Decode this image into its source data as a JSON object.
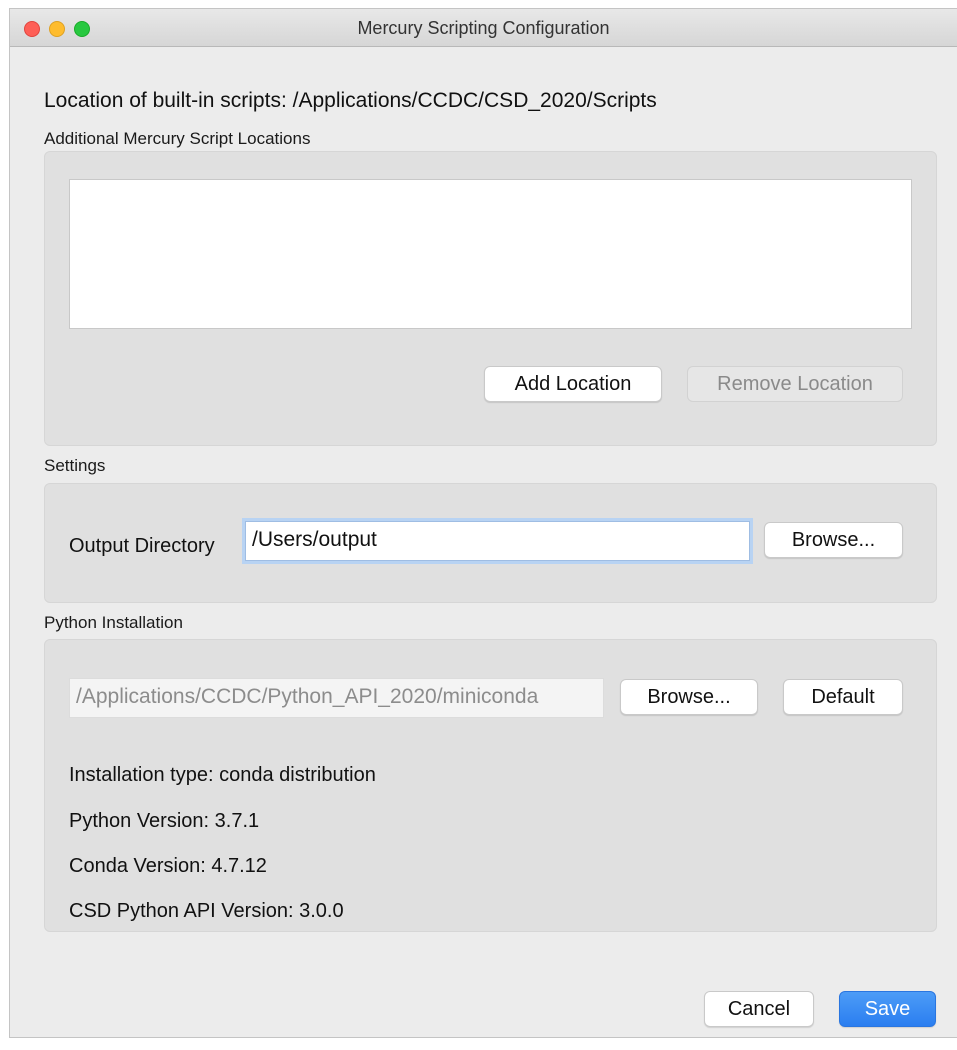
{
  "window": {
    "title": "Mercury Scripting Configuration"
  },
  "builtin": {
    "label": "Location of built-in scripts: /Applications/CCDC/CSD_2020/Scripts"
  },
  "additional": {
    "label": "Additional Mercury Script Locations",
    "add_button": "Add Location",
    "remove_button": "Remove Location"
  },
  "settings": {
    "label": "Settings",
    "output_label": "Output Directory",
    "output_value": "/Users/output",
    "browse_button": "Browse..."
  },
  "python": {
    "label": "Python Installation",
    "path_value": "/Applications/CCDC/Python_API_2020/miniconda",
    "browse_button": "Browse...",
    "default_button": "Default",
    "installation_type": "Installation type: conda distribution",
    "python_version": "Python Version: 3.7.1",
    "conda_version": "Conda Version: 4.7.12",
    "api_version": "CSD Python API Version: 3.0.0"
  },
  "footer": {
    "cancel_button": "Cancel",
    "save_button": "Save"
  },
  "colors": {
    "accent": "#2b7ef0",
    "close": "#fe5f57",
    "minimize": "#febc2e",
    "maximize": "#28c840"
  }
}
